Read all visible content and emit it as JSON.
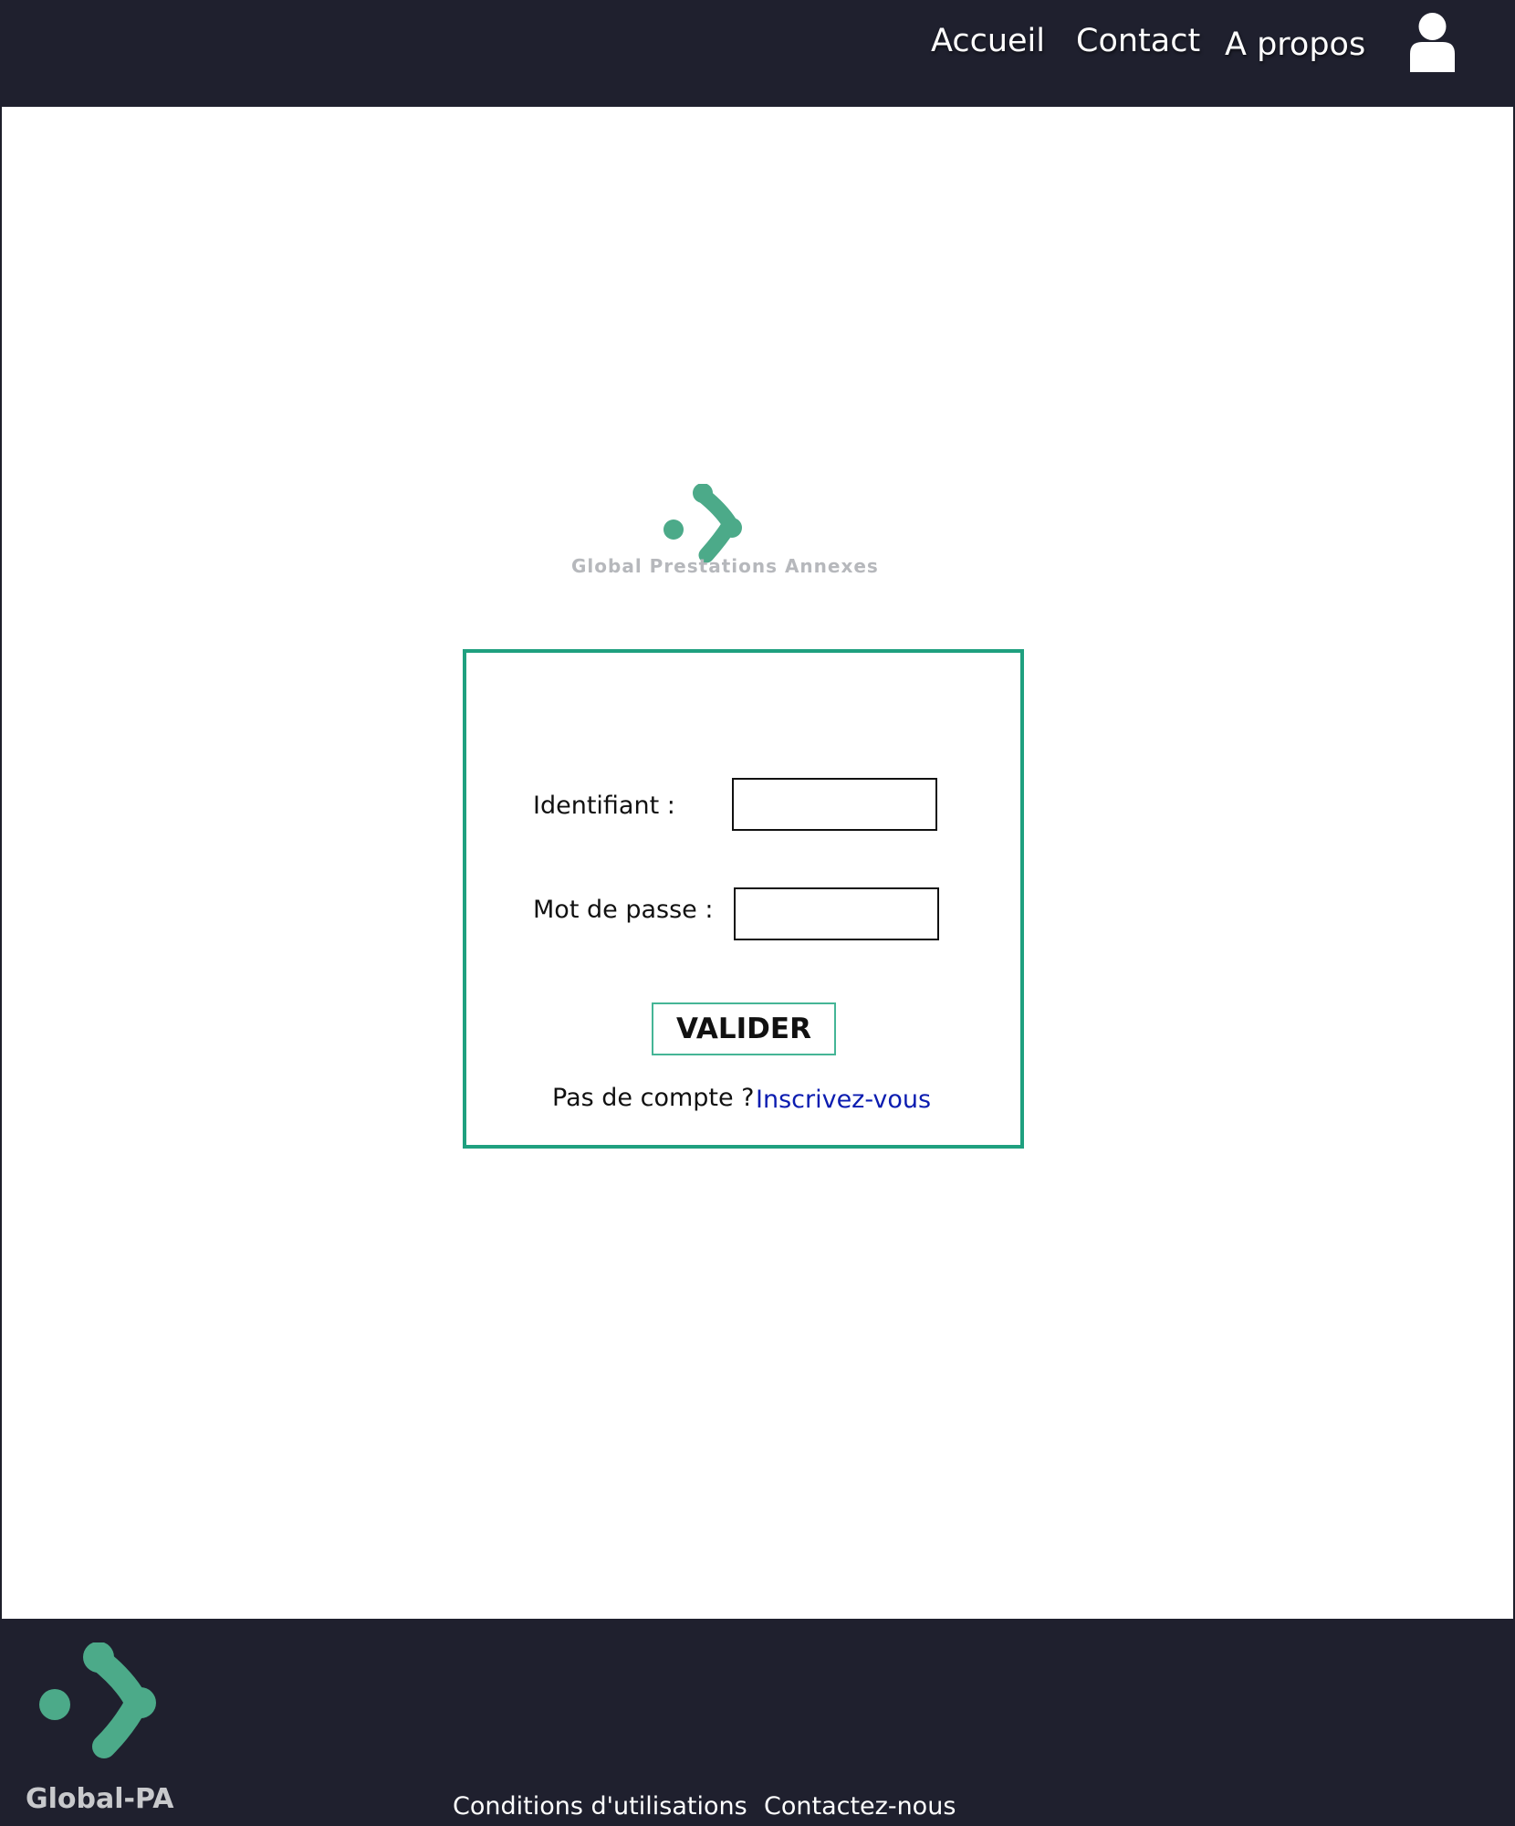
{
  "header": {
    "nav": [
      {
        "label": "Accueil"
      },
      {
        "label": "Contact"
      },
      {
        "label": "A propos"
      }
    ],
    "user_icon": "user-icon"
  },
  "main": {
    "logo": {
      "icon": "global-pa-logo-icon",
      "tagline": "Global Prestations Annexes",
      "color": "#4caa89"
    },
    "login": {
      "identifiant_label": "Identifiant :",
      "identifiant_value": "",
      "password_label": "Mot de passe :",
      "password_value": "",
      "submit_label": "VALIDER",
      "signup_prompt": "Pas de compte ?",
      "signup_link": "Inscrivez-vous",
      "border_color": "#1fa07f"
    }
  },
  "footer": {
    "brand": "Global-PA",
    "links": [
      {
        "label": "Conditions d'utilisations"
      },
      {
        "label": "Contactez-nous"
      }
    ]
  },
  "colors": {
    "header_bg": "#1f202e",
    "footer_bg": "#1f202e",
    "accent": "#4caa89",
    "link": "#0b1cb0"
  }
}
